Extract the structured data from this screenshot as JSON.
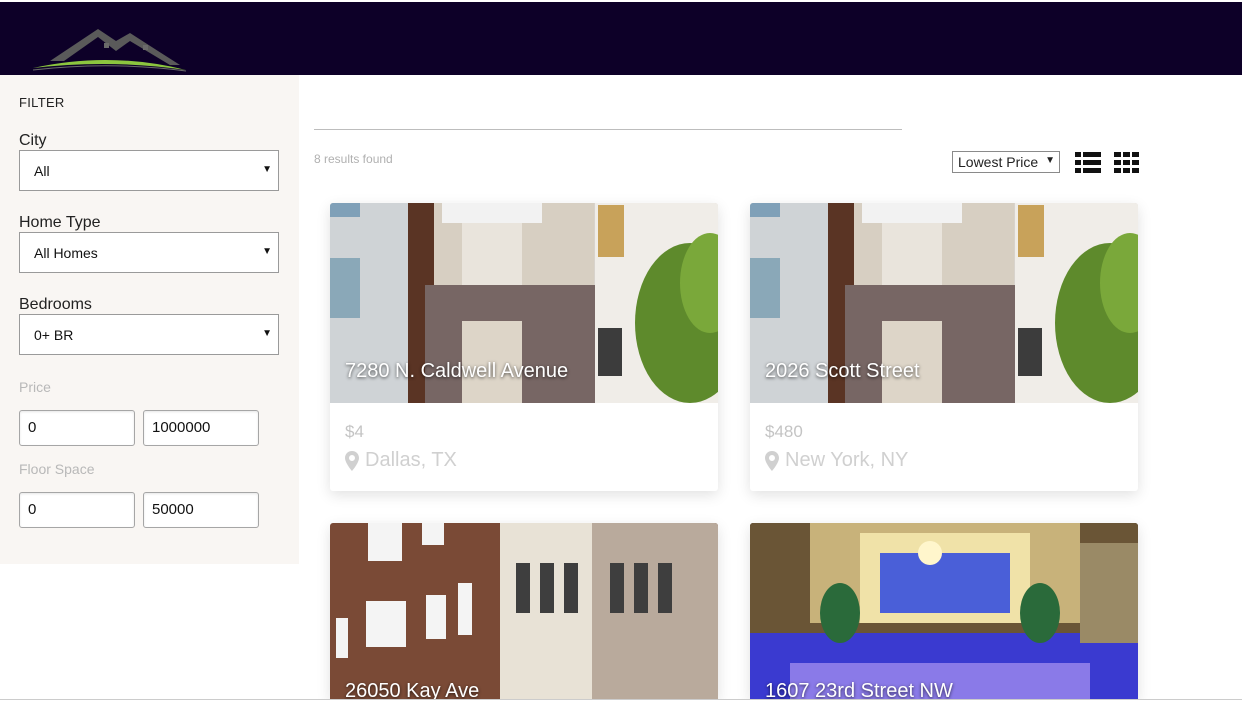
{
  "header": {
    "logo_icon": "house-roof-logo",
    "brand_color": "#0d0028"
  },
  "sidebar": {
    "filter_title": "FILTER",
    "city": {
      "label": "City",
      "value": "All"
    },
    "home_type": {
      "label": "Home Type",
      "value": "All Homes"
    },
    "bedrooms": {
      "label": "Bedrooms",
      "value": "0+ BR"
    },
    "price": {
      "label": "Price",
      "min": "0",
      "max": "1000000"
    },
    "floor_space": {
      "label": "Floor Space",
      "min": "0",
      "max": "50000"
    }
  },
  "main": {
    "results_text": "8 results found",
    "sort": {
      "value": "Lowest Price"
    },
    "view_icons": [
      "list-view-icon",
      "grid-view-icon"
    ],
    "listings": [
      {
        "title": "7280 N. Caldwell Avenue",
        "price": "$4",
        "location": "Dallas, TX"
      },
      {
        "title": "2026 Scott Street",
        "price": "$480",
        "location": "New York, NY"
      },
      {
        "title": "26050 Kay Ave",
        "price": "",
        "location": ""
      },
      {
        "title": "1607 23rd Street NW",
        "price": "",
        "location": ""
      }
    ]
  }
}
